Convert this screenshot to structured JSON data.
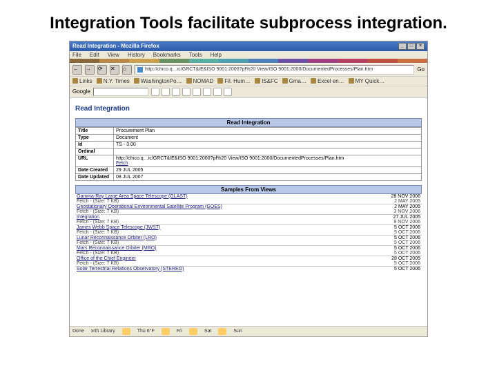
{
  "slide_heading": "Integration Tools facilitate subprocess integration.",
  "window": {
    "title": "Read Integration - Mozilla Firefox",
    "min": "_",
    "max": "□",
    "close": "×"
  },
  "menu": {
    "file": "File",
    "edit": "Edit",
    "view": "View",
    "history": "History",
    "bookmarks": "Bookmarks",
    "tools": "Tools",
    "help": "Help"
  },
  "nav": {
    "back": "←",
    "forward": "→",
    "reload": "⟳",
    "stop": "✕",
    "home": "⌂"
  },
  "url": "http://chico.q…ic/GRCT&IE&ISO 9001:2000?pf%20 View/ISO 9001:2000/DocumentedProcesses/Plan.htm",
  "go_label": "Go",
  "bookmarks": [
    "Links",
    "N.Y. Times",
    "WashingtonPo…",
    "NOMAD",
    "Fil. Hum…",
    "IS&FC",
    "Gma…",
    "Excel en…",
    "MY Quick…"
  ],
  "google": {
    "label": "Google"
  },
  "page": {
    "heading": "Read Integration",
    "section_header": "Read Integration",
    "fields": {
      "title_label": "Title",
      "title_value": "Procurement Plan",
      "type_label": "Type",
      "type_value": "Document",
      "id_label": "Id",
      "id_value": "TS - 3.00",
      "ordinal_label": "Ordinal",
      "ordinal_value": "",
      "url_label": "URL",
      "url_value": "http://chico.q…ic/GRCT&IE&ISO 9001:2000?pf%20 View/ISO 9001:2000/DocumentedProcesses/Plan.htm",
      "fetch_label": "Fetch",
      "created_label": "Date Created",
      "created_value": "29 JUL 2005",
      "updated_label": "Date Updated",
      "updated_value": "08 JUL 2007"
    },
    "samples_header": "Samples From Views",
    "samples": [
      {
        "name": "Gamma-Ray Large Area Space Telescope (GLAST)",
        "date": "28 NOV 2006",
        "fetch": "Fetch - (Size: 7 KB)",
        "fetch_date": "2 MAY 2005"
      },
      {
        "name": "Geostationary Operational Environmental Satellite Program (GOES)",
        "date": "2 MAY 2005",
        "fetch": "Fetch - (Size: 7 KB)",
        "fetch_date": "3 NOV 2006"
      },
      {
        "name": "Integration",
        "date": "27 JUL 2005",
        "fetch": "Fetch - (Size: 7 KB)",
        "fetch_date": "9 NOV 2006"
      },
      {
        "name": "James Webb Space Telescope (JWST)",
        "date": "5 OCT 2006",
        "fetch": "Fetch - (Size: 7 KB)",
        "fetch_date": "5 OCT 2006"
      },
      {
        "name": "Lunar Reconnaissance Orbiter (LRO)",
        "date": "5 OCT 2006",
        "fetch": "Fetch - (Size: 7 KB)",
        "fetch_date": "5 OCT 2006"
      },
      {
        "name": "Mars Reconnaissance Orbiter (MRO)",
        "date": "5 OCT 2006",
        "fetch": "Fetch - (Size: 7 KB)",
        "fetch_date": "5 OCT 2006"
      },
      {
        "name": "Office of the Chief Engineer",
        "date": "28 OCT 2005",
        "fetch": "Fetch - (Size: 7 KB)",
        "fetch_date": "5 OCT 2006"
      },
      {
        "name": "Solar Terrestrial Relations Observatory (STEREO)",
        "date": "5 OCT 2006",
        "fetch": "",
        "fetch_date": ""
      }
    ]
  },
  "statusbar": {
    "done": "Done",
    "q1": "xrth Library",
    "q2": "",
    "q3": "",
    "weather": "Thu 6°F",
    "fri": "Fri",
    "sat": "Sat",
    "sun": "Sun"
  },
  "colors": [
    "#8a6a3a",
    "#b88a4a",
    "#c8a050",
    "#6a9060",
    "#5ab0a0",
    "#50a0b0",
    "#5080b8",
    "#6a50a0",
    "#a04080",
    "#b84060",
    "#c05040",
    "#c87040"
  ]
}
